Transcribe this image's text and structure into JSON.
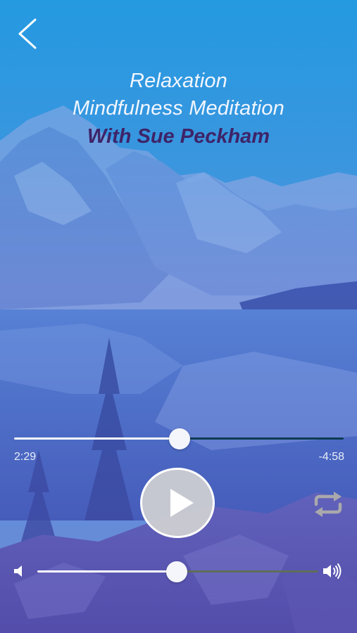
{
  "header": {
    "back_icon": "chevron-left-icon"
  },
  "track": {
    "title_line1": "Relaxation",
    "title_line2": "Mindfulness Meditation",
    "author": "With Sue Peckham"
  },
  "player": {
    "elapsed": "2:29",
    "remaining": "-4:58",
    "progress_fraction": 0.503,
    "play_icon": "play-icon",
    "repeat_icon": "repeat-icon"
  },
  "volume": {
    "level_fraction": 0.495,
    "min_icon": "volume-low-icon",
    "max_icon": "volume-high-icon"
  },
  "colors": {
    "title_text": "#f2f6ff",
    "author_text": "#3e2468",
    "accent_overlay": "#2f8fe0"
  }
}
